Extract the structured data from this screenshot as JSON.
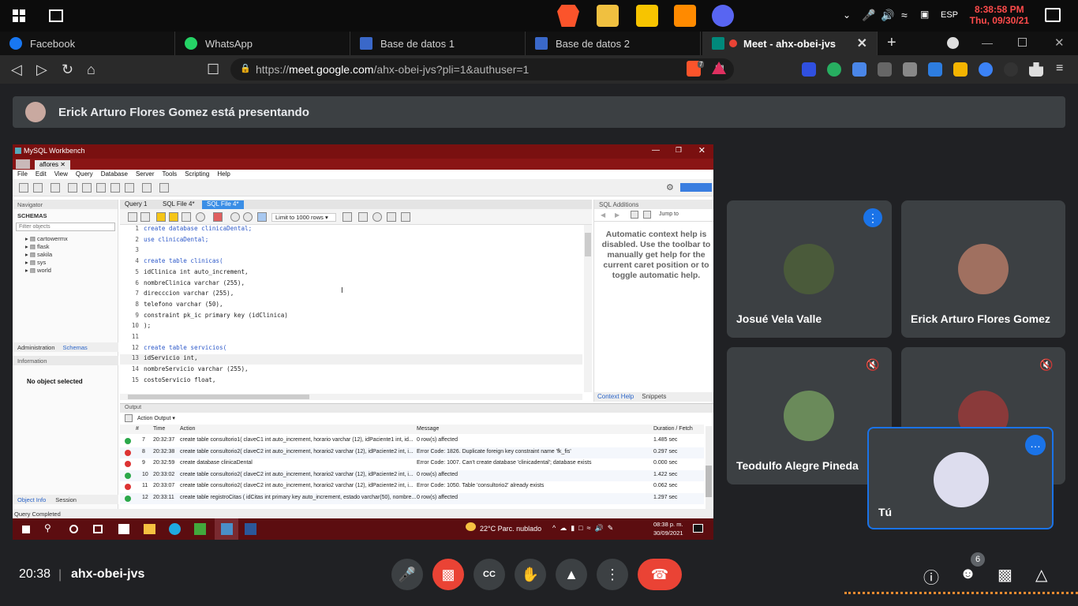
{
  "taskbar_top": {
    "clock_time": "8:38:58 PM",
    "clock_date": "Thu, 09/30/21",
    "language": "ESP"
  },
  "browser": {
    "tabs": [
      {
        "label": "Facebook",
        "color": "#1877f2"
      },
      {
        "label": "WhatsApp",
        "color": "#25d366"
      },
      {
        "label": "Base de datos 1",
        "color": "#3a68c9"
      },
      {
        "label": "Base de datos 2",
        "color": "#3a68c9"
      },
      {
        "label": "Meet - ahx-obei-jvs",
        "color": "#00897b"
      }
    ],
    "url_prefix": "https://",
    "url_host": "meet.google.com",
    "url_path": "/ahx-obei-jvs?pli=1&authuser=1",
    "ext_badge": "7"
  },
  "presenting": {
    "text": "Erick Arturo Flores Gomez está presentando"
  },
  "workbench": {
    "title": "MySQL Workbench",
    "conn_tab": "aflores",
    "menu": [
      "File",
      "Edit",
      "View",
      "Query",
      "Database",
      "Server",
      "Tools",
      "Scripting",
      "Help"
    ],
    "navigator_label": "Navigator",
    "schemas_label": "SCHEMAS",
    "filter_placeholder": "Filter objects",
    "schemas": [
      "cartowermx",
      "flask",
      "sakila",
      "sys",
      "world"
    ],
    "nav_tabs": [
      "Administration",
      "Schemas"
    ],
    "information_label": "Information",
    "no_object": "No object selected",
    "bottom_tabs": [
      "Object Info",
      "Session"
    ],
    "editor_tabs": [
      "Query 1",
      "SQL File 4*",
      "SQL File 4*"
    ],
    "limit_label": "Limit to 1000 rows",
    "code_lines": [
      {
        "n": "1",
        "text": "create database clinicaDental;"
      },
      {
        "n": "2",
        "text": "use clinicaDental;"
      },
      {
        "n": "3",
        "text": ""
      },
      {
        "n": "4",
        "text": "create table clinicas("
      },
      {
        "n": "5",
        "text": "idClinica int auto_increment,"
      },
      {
        "n": "6",
        "text": "nombreClinica varchar (255),"
      },
      {
        "n": "7",
        "text": "direcccion varchar (255),"
      },
      {
        "n": "8",
        "text": "telefono varchar (50),"
      },
      {
        "n": "9",
        "text": "constraint pk_ic primary key (idClinica)"
      },
      {
        "n": "10",
        "text": ");"
      },
      {
        "n": "11",
        "text": ""
      },
      {
        "n": "12",
        "text": "create table servicios("
      },
      {
        "n": "13",
        "text": "idServicio int,"
      },
      {
        "n": "14",
        "text": "nombreServicio varchar (255),"
      },
      {
        "n": "15",
        "text": "costoServicio float,"
      }
    ],
    "sql_additions_label": "SQL Additions",
    "jump_to": "Jump to",
    "context_help": "Automatic context help is disabled. Use the toolbar to manually get help for the current caret position or to toggle automatic help.",
    "addition_tabs": [
      "Context Help",
      "Snippets"
    ],
    "output_label": "Output",
    "output_select": "Action Output",
    "output_headers": [
      "#",
      "Time",
      "Action",
      "Message",
      "Duration / Fetch"
    ],
    "output_rows": [
      {
        "status": "ok",
        "n": "7",
        "time": "20:32:37",
        "action": "create table consultorio1( claveC1 int auto_increment, horario varchar (12), idPaciente1 int, id...",
        "message": "0 row(s) affected",
        "duration": "1.485 sec"
      },
      {
        "status": "err",
        "n": "8",
        "time": "20:32:38",
        "action": "create table consultorio2( claveC2 int auto_increment, horario2 varchar (12), idPaciente2 int, i...",
        "message": "Error Code: 1826. Duplicate foreign key constraint name 'fk_fis'",
        "duration": "0.297 sec"
      },
      {
        "status": "err",
        "n": "9",
        "time": "20:32:59",
        "action": "create database clinicaDental",
        "message": "Error Code: 1007. Can't create database 'clinicadental'; database exists",
        "duration": "0.000 sec"
      },
      {
        "status": "ok",
        "n": "10",
        "time": "20:33:02",
        "action": "create table consultorio2( claveC2 int auto_increment, horario2 varchar (12), idPaciente2 int, i...",
        "message": "0 row(s) affected",
        "duration": "1.422 sec"
      },
      {
        "status": "err",
        "n": "11",
        "time": "20:33:07",
        "action": "create table consultorio2( claveC2 int auto_increment, horario2 varchar (12), idPaciente2 int, i...",
        "message": "Error Code: 1050. Table 'consultorio2' already exists",
        "duration": "0.062 sec"
      },
      {
        "status": "ok",
        "n": "12",
        "time": "20:33:11",
        "action": "create table registroCitas ( idCitas int primary key auto_increment, estado varchar(50), nombre...",
        "message": "0 row(s) affected",
        "duration": "1.297 sec"
      }
    ],
    "status": "Query Completed",
    "inner_weather": "22°C  Parc. nublado",
    "inner_time": "08:38 p. m.",
    "inner_date": "30/09/2021"
  },
  "participants": [
    {
      "name": "Josué Vela Valle",
      "muted": false
    },
    {
      "name": "Erick Arturo Flores Gomez",
      "muted": false
    },
    {
      "name": "Teodulfo Alegre Pineda",
      "muted": true
    },
    {
      "name": "",
      "muted": true
    },
    {
      "name": "Tú",
      "muted": false
    }
  ],
  "bottom_bar": {
    "time": "20:38",
    "meeting_code": "ahx-obei-jvs",
    "people_count": "6"
  }
}
